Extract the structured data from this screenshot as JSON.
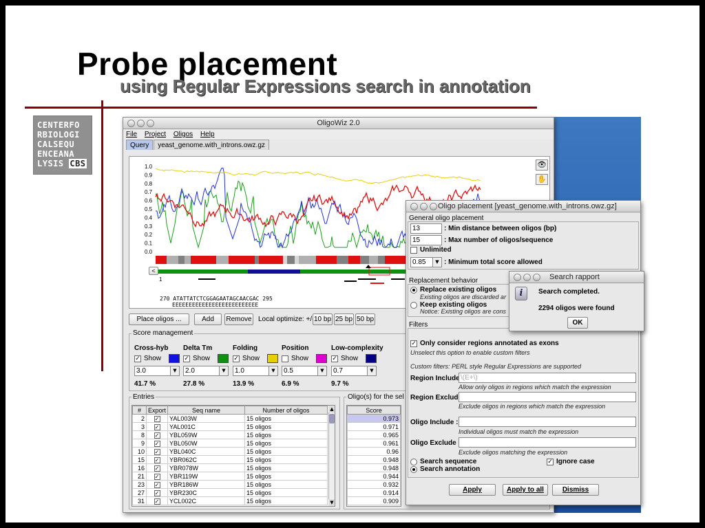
{
  "slide": {
    "title": "Probe placement",
    "subtitle": "using Regular Expressions search in annotation",
    "logo_lines": [
      "CENTERFO",
      "RBIOLOGI",
      "CALSEQU",
      "ENCEANA",
      "LYSIS "
    ],
    "logo_cbs": "CBS"
  },
  "main_window": {
    "title": "OligoWiz 2.0",
    "menu": [
      "File",
      "Project",
      "Oligos",
      "Help"
    ],
    "tabs": [
      "Query",
      "yeast_genome.with_introns.owz.gz"
    ],
    "y_axis_ticks": [
      "1.0",
      "0.9",
      "0.8",
      "0.7",
      "0.6",
      "0.5",
      "0.4",
      "0.3",
      "0.2",
      "0.1",
      "0.0"
    ],
    "seq_start": "1",
    "nav_left": "<",
    "sequence_line": "270 ATATTATCTCGGAGAATAGCAACGAC 295",
    "sequence_marks": "EEEEEEEEEEEEEEEEEEEEEEEEEE",
    "buttons": {
      "place_oligos": "Place oligos ...",
      "add": "Add",
      "remove": "Remove",
      "local_optimize": "Local optimize: +/-",
      "bp10": "10 bp",
      "bp25": "25 bp",
      "bp50": "50 bp"
    },
    "score_management": {
      "title": "Score management",
      "show_label": "Show",
      "columns": [
        {
          "name": "Cross-hyb",
          "show": true,
          "value": "3.0",
          "pct": "41.7 %",
          "color": "#1010e0"
        },
        {
          "name": "Delta Tm",
          "show": true,
          "value": "2.0",
          "pct": "27.8 %",
          "color": "#109010"
        },
        {
          "name": "Folding",
          "show": true,
          "value": "1.0",
          "pct": "13.9 %",
          "color": "#e8d000"
        },
        {
          "name": "Position",
          "show": false,
          "value": "0.5",
          "pct": "6.9 %",
          "color": "#e000d0"
        },
        {
          "name": "Low-complexity",
          "show": true,
          "value": "0.7",
          "pct": "9.7 %",
          "color": "#000080"
        }
      ]
    },
    "entries": {
      "title": "Entries",
      "headers": [
        "#",
        "Export",
        "Seq name",
        "Number of oligos"
      ],
      "rows": [
        {
          "n": "2",
          "name": "YAL003W",
          "oligos": "15 oligos"
        },
        {
          "n": "3",
          "name": "YAL001C",
          "oligos": "15 oligos"
        },
        {
          "n": "8",
          "name": "YBL059W",
          "oligos": "15 oligos"
        },
        {
          "n": "9",
          "name": "YBL050W",
          "oligos": "15 oligos"
        },
        {
          "n": "10",
          "name": "YBL040C",
          "oligos": "15 oligos"
        },
        {
          "n": "15",
          "name": "YBR062C",
          "oligos": "15 oligos"
        },
        {
          "n": "16",
          "name": "YBR078W",
          "oligos": "15 oligos"
        },
        {
          "n": "21",
          "name": "YBR119W",
          "oligos": "15 oligos"
        },
        {
          "n": "23",
          "name": "YBR186W",
          "oligos": "15 oligos"
        },
        {
          "n": "27",
          "name": "YBR230C",
          "oligos": "15 oligos"
        },
        {
          "n": "31",
          "name": "YCL002C",
          "oligos": "15 oligos"
        }
      ]
    },
    "oligos_panel": {
      "title": "Oligo(s) for the sel",
      "header": "Score",
      "scores": [
        "0.973",
        "0.971",
        "0.965",
        "0.961",
        "0.96",
        "0.948",
        "0.948",
        "0.944",
        "0.932",
        "0.914",
        "0.909"
      ]
    }
  },
  "placement_dialog": {
    "title": "Oligo placement [yeast_genome.with_introns.owz.gz]",
    "general": {
      "title": "General oligo placement",
      "min_distance_value": "13",
      "min_distance_label": ": Min distance between oligos (bp)",
      "max_number_value": "15",
      "max_number_label": ": Max number of oligos/sequence",
      "unlimited_label": "Unlimited",
      "min_score_value": "0.85",
      "min_score_label": ": Minimum total score allowed"
    },
    "replacement": {
      "title": "Replacement behavior",
      "replace_label": "Replace existing oligos",
      "replace_note": "Existing oligos are discarded ar",
      "keep_label": "Keep existing oligos",
      "keep_note": "Notice: Existing oligos are cons"
    },
    "filters": {
      "title": "Filters",
      "exons_label": "Only consider regions annotated as exons",
      "exons_note": "Unselect this option to enable custom filters",
      "custom_note": "Custom filters: PERL style Regular Expressions are supported",
      "region_include_label": "Region Include:",
      "region_include_value": "\\(E+\\)",
      "region_include_note": "Allow only oligos in regions which match the expression",
      "region_exclude_label": "Region Exclude:",
      "region_exclude_note": "Exclude oligos in regions which match the expression",
      "oligo_include_label": "Oligo Include :",
      "oligo_include_note": "Individual oligos must match the expression",
      "oligo_exclude_label": "Oligo Exclude :",
      "oligo_exclude_note": "Exclude oligos matching the expression",
      "search_sequence_label": "Search sequence",
      "search_annotation_label": "Search annotation",
      "ignore_case_label": "Ignore case"
    },
    "buttons": {
      "apply": "Apply",
      "apply_all": "Apply to all",
      "dismiss": "Dismiss"
    }
  },
  "search_dialog": {
    "title": "Search rapport",
    "line1": "Search completed.",
    "line2": "2294 oligos were found",
    "ok": "OK"
  }
}
